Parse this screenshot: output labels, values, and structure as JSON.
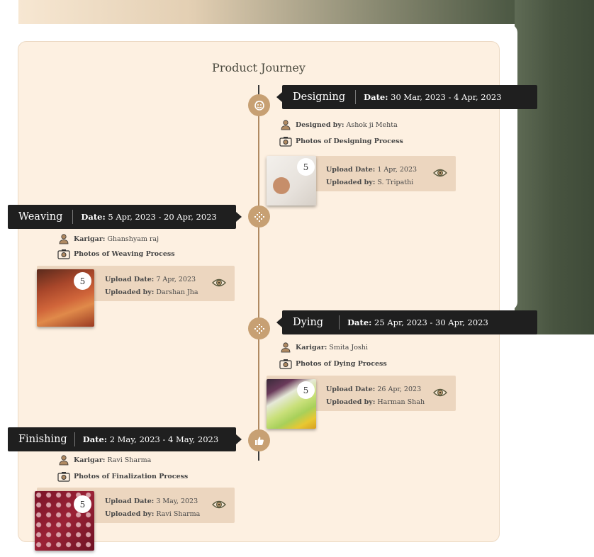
{
  "title": "Product Journey",
  "stages": [
    {
      "name": "Designing",
      "date_label": "Date:",
      "date_range": "30 Mar, 2023 - 4 Apr, 2023",
      "person_label": "Designed by:",
      "person": "Ashok ji Mehta",
      "photos_label": "Photos of Designing Process",
      "photo_count": "5",
      "upload_date_label": "Upload Date:",
      "upload_date": "1 Apr, 2023",
      "uploaded_by_label": "Uploaded by:",
      "uploaded_by": "S. Tripathi",
      "icon": "face-icon"
    },
    {
      "name": "Weaving",
      "date_label": "Date:",
      "date_range": "5 Apr, 2023 - 20 Apr, 2023",
      "person_label": "Karigar:",
      "person": "Ghanshyam raj",
      "photos_label": "Photos of Weaving Process",
      "photo_count": "5",
      "upload_date_label": "Upload Date:",
      "upload_date": "7 Apr, 2023",
      "uploaded_by_label": "Uploaded by:",
      "uploaded_by": "Darshan Jha",
      "icon": "pattern-icon"
    },
    {
      "name": "Dying",
      "date_label": "Date:",
      "date_range": "25 Apr, 2023 - 30 Apr, 2023",
      "person_label": "Karigar:",
      "person": "Smita Joshi",
      "photos_label": "Photos of Dying Process",
      "photo_count": "5",
      "upload_date_label": "Upload Date:",
      "upload_date": "26 Apr, 2023",
      "uploaded_by_label": "Uploaded by:",
      "uploaded_by": "Harman Shah",
      "icon": "pattern-icon"
    },
    {
      "name": "Finishing",
      "date_label": "Date:",
      "date_range": "2 May, 2023 - 4 May, 2023",
      "person_label": "Karigar:",
      "person": "Ravi Sharma",
      "photos_label": "Photos of Finalization Process",
      "photo_count": "5",
      "upload_date_label": "Upload Date:",
      "upload_date": "3 May, 2023",
      "uploaded_by_label": "Uploaded by:",
      "uploaded_by": "Ravi Sharma",
      "icon": "thumbs-up-icon"
    }
  ],
  "colors": {
    "accent": "#c7a073",
    "bar": "#1f1f1f",
    "card": "#fdf0e1",
    "upload_box": "#ecd6bf"
  }
}
